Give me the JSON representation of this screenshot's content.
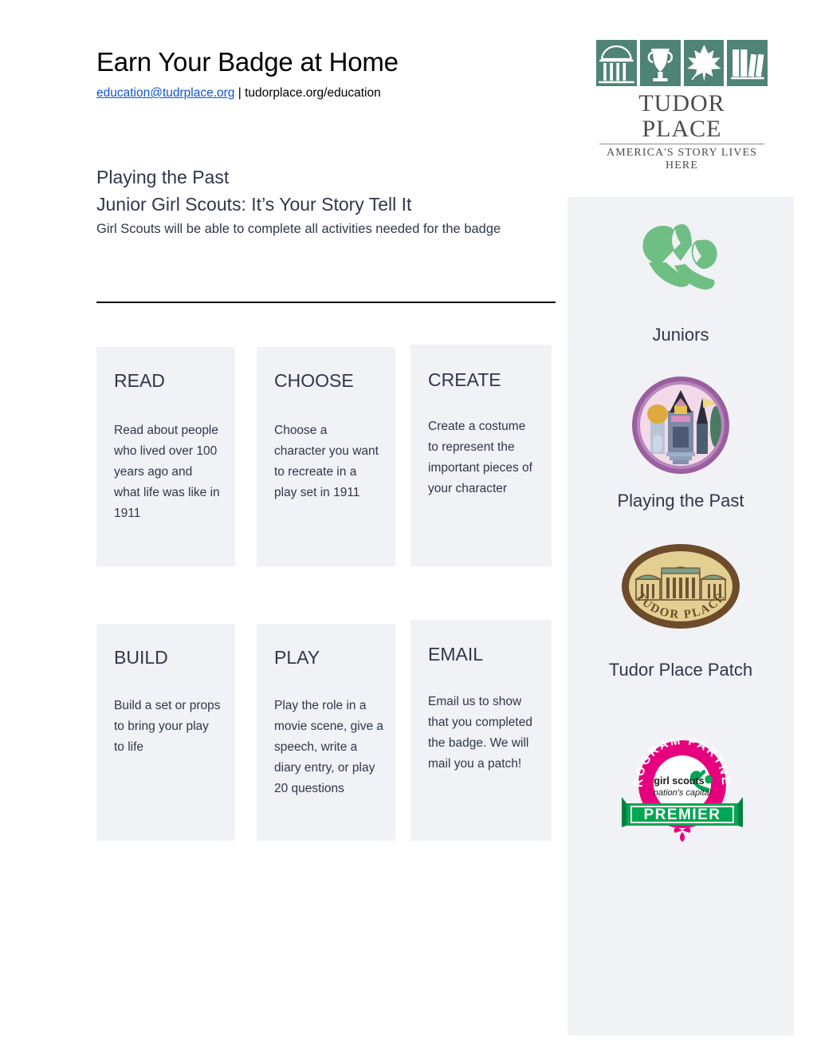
{
  "header": {
    "title": "Earn Your Badge at Home",
    "email": "education@tudrplace.org",
    "separator": " | ",
    "website": "tudorplace.org/education",
    "logo": {
      "wordmark": "TUDOR PLACE",
      "tagline": "AMERICA'S STORY LIVES HERE",
      "tile_icons": [
        "rotunda-icon",
        "urn-icon",
        "leaf-icon",
        "books-icon"
      ],
      "color": "#4f8376"
    }
  },
  "intro": {
    "program_title": "Playing the Past",
    "audience_title": "Junior Girl Scouts: It’s Your Story Tell It",
    "description": "Girl Scouts will be able to complete all activities needed for the badge"
  },
  "activities": [
    {
      "title": "READ",
      "body": "Read about people who lived over 100 years ago and what life was like in 1911"
    },
    {
      "title": "CHOOSE",
      "body": "Choose a character you want to recreate in a play set in 1911"
    },
    {
      "title": "CREATE",
      "body": "Create a costume to represent the important pieces of your character"
    },
    {
      "title": "BUILD",
      "body": "Build a set or props to bring your play to life"
    },
    {
      "title": "PLAY",
      "body": "Play the role in a movie scene, give a speech, write a diary entry, or play 20 questions"
    },
    {
      "title": "EMAIL",
      "body": "Email us to show that you completed the badge. We will mail you a patch!"
    }
  ],
  "sidebar": {
    "juniors_label": "Juniors",
    "playing_label": "Playing the Past",
    "tudor_label": "Tudor Place Patch",
    "trefoil_icon": "girl-scouts-trefoil-icon",
    "trefoil_color": "#6fbf85",
    "badge_playing_icon": "playing-the-past-badge-icon",
    "badge_tudor_icon": "tudor-place-patch-icon",
    "premier_badge": {
      "arc_text": "PROGRAM PARTNER",
      "council_line1": "girl scouts",
      "council_line2": "nation's capital",
      "banner_text": "PREMIER",
      "pink": "#e6007e",
      "green": "#00a651"
    }
  },
  "colors": {
    "card_bg": "#f1f2f6",
    "text": "#2f3749",
    "link": "#1155cc",
    "brand_green": "#4f8376"
  }
}
